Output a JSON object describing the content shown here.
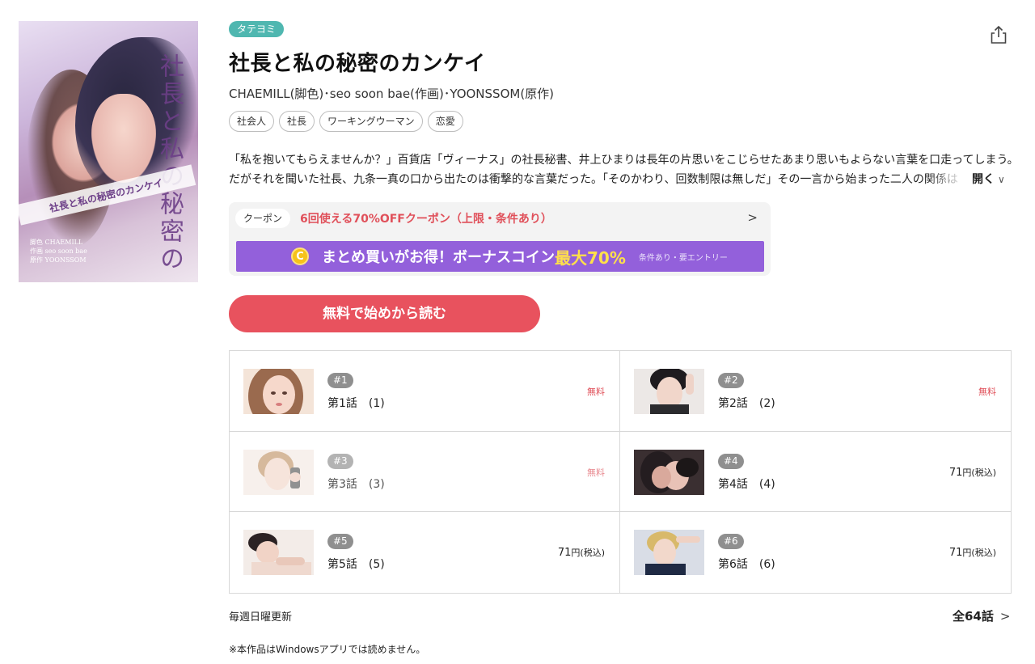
{
  "cover": {
    "vertical_title": "社長と私の秘密の",
    "band_title": "社長と私の秘密のカンケイ",
    "credits": [
      "脚色 CHAEMILL",
      "作画 seo soon bae",
      "原作 YOONSSOM"
    ]
  },
  "badge": "タテヨミ",
  "title": "社長と私の秘密のカンケイ",
  "authors": "CHAEMILL(脚色)･seo soon bae(作画)･YOONSSOM(原作)",
  "tags": [
    "社会人",
    "社長",
    "ワーキングウーマン",
    "恋愛"
  ],
  "description": {
    "line1": "「私を抱いてもらえませんか？」百貨店「ヴィーナス」の社長秘書、井上ひまりは長年の片思いをこじらせたあまり思いもよらない言葉を口走ってしまう。",
    "line2": "だがそれを聞いた社長、九条一真の口から出たのは衝撃的な言葉だった。「そのかわり、回数制限は無しだ」その一言から始まった二人の関係は",
    "open_label": "開く",
    "open_icon": "chevron-down-icon"
  },
  "coupon": {
    "pill": "クーポン",
    "text": "6回使える70%OFFクーポン（上限・条件あり）",
    "arrow": ">"
  },
  "promo": {
    "coin_symbol": "C",
    "main": "まとめ買いがお得！ボーナスコイン",
    "highlight": "最大70%",
    "small": "条件あり・要エントリー"
  },
  "read_button": "無料で始めから読む",
  "episodes": [
    {
      "num": "#1",
      "name": "第1話　(1)",
      "price_free": "無料"
    },
    {
      "num": "#2",
      "name": "第2話　(2)",
      "price_free": "無料"
    },
    {
      "num": "#3",
      "name": "第3話　(3)",
      "price_free": "無料"
    },
    {
      "num": "#4",
      "name": "第4話　(4)",
      "price": "71",
      "price_unit": "円(税込)"
    },
    {
      "num": "#5",
      "name": "第5話　(5)",
      "price": "71",
      "price_unit": "円(税込)"
    },
    {
      "num": "#6",
      "name": "第6話　(6)",
      "price": "71",
      "price_unit": "円(税込)"
    }
  ],
  "weekly": "毎週日曜更新",
  "total": "全64話",
  "total_chev": ">",
  "note": "※本作品はWindowsアプリでは読めません。",
  "colors": {
    "badge": "#4fb7b0",
    "accent_red": "#e8525e",
    "promo_purple": "#9360db",
    "promo_yellow": "#ffe04a"
  }
}
